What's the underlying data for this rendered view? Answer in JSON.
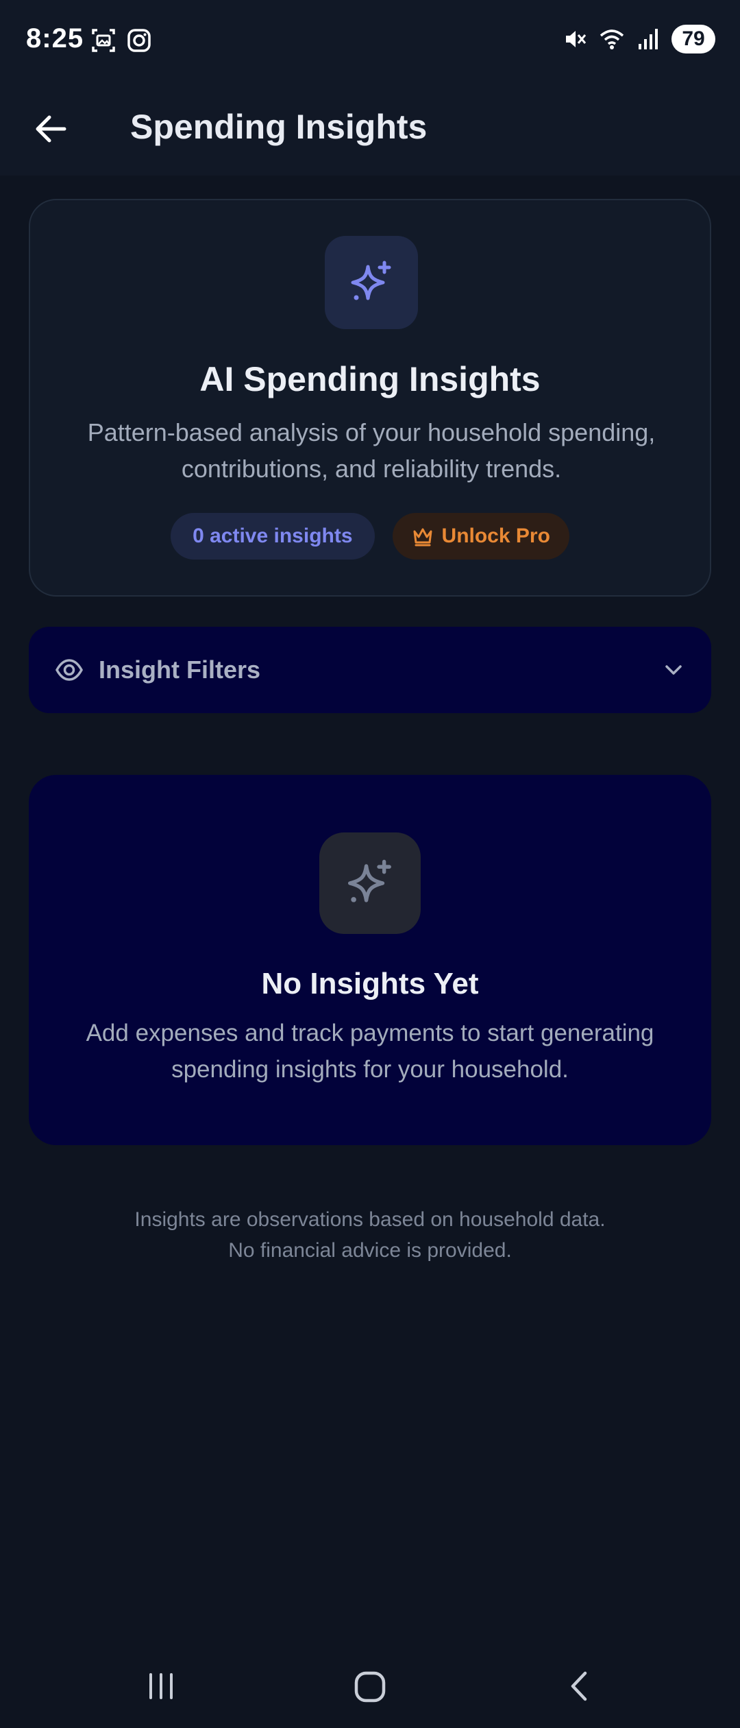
{
  "status_bar": {
    "time": "8:25",
    "battery": "79",
    "icons": [
      "screenshot-icon",
      "instagram-icon",
      "mute-icon",
      "wifi-icon",
      "signal-icon"
    ]
  },
  "app_bar": {
    "title": "Spending Insights",
    "back_icon": "arrow-left-icon"
  },
  "hero": {
    "icon": "sparkles-icon",
    "title": "AI Spending Insights",
    "description": "Pattern-based analysis of your household spending, contributions, and reliability trends.",
    "active_badge": "0 active insights",
    "pro_badge": "Unlock Pro",
    "accent_color": "#7f88f0",
    "pro_color": "#e98935"
  },
  "filters": {
    "label": "Insight Filters",
    "icon": "eye-icon",
    "expand_icon": "chevron-down-icon"
  },
  "empty_state": {
    "icon": "sparkles-icon",
    "title": "No Insights Yet",
    "description": "Add expenses and track payments to start generating spending insights for your household."
  },
  "disclaimer": {
    "line1": "Insights are observations based on household data.",
    "line2": "No financial advice is provided."
  },
  "nav_bar": {
    "icons": [
      "recent-apps-icon",
      "home-icon",
      "back-nav-icon"
    ]
  }
}
